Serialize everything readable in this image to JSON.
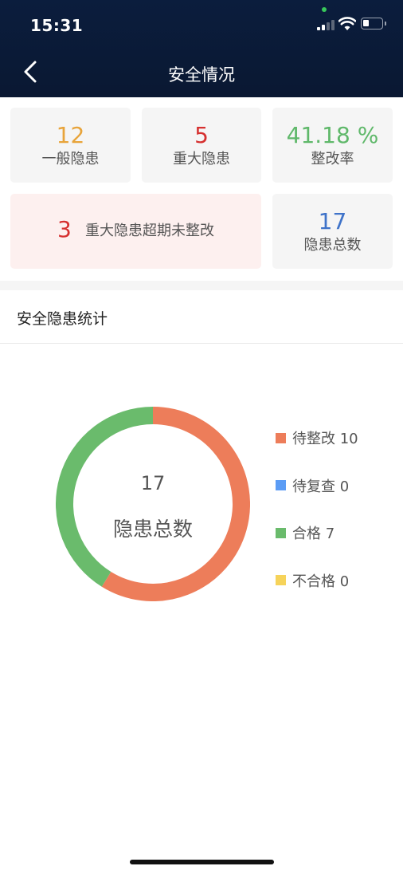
{
  "status_bar": {
    "time": "15:31"
  },
  "header": {
    "title": "安全情况"
  },
  "stats": {
    "general": {
      "value": "12",
      "label": "一般隐患",
      "color": "#e8a43a"
    },
    "major": {
      "value": "5",
      "label": "重大隐患",
      "color": "#d6302f"
    },
    "rectify_rate": {
      "value": "41.18 %",
      "label": "整改率",
      "color": "#5fb86a"
    },
    "overdue": {
      "value": "3",
      "label": "重大隐患超期未整改",
      "color": "#d6302f"
    },
    "total": {
      "value": "17",
      "label": "隐患总数",
      "color": "#3f73c9"
    }
  },
  "section": {
    "title": "安全隐患统计"
  },
  "chart_data": {
    "type": "pie",
    "center_value": "17",
    "center_label": "隐患总数",
    "categories": [
      "待整改",
      "待复查",
      "合格",
      "不合格"
    ],
    "values": [
      10,
      0,
      7,
      0
    ],
    "colors": [
      "#ed7d5a",
      "#5b9cf5",
      "#6abb6c",
      "#f6d35a"
    ],
    "legend_labels": [
      "待整改 10",
      "待复查 0",
      "合格 7",
      "不合格 0"
    ],
    "legend_position": "right"
  }
}
